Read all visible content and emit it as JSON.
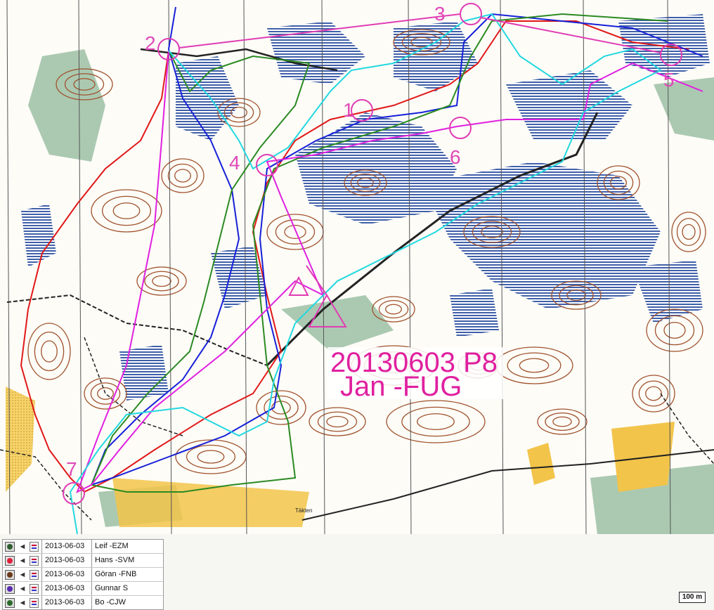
{
  "map": {
    "title_line1": "20130603 P8",
    "title_line2": "Jan -FUG",
    "place_label": "Täkten",
    "controls": [
      "1",
      "2",
      "3",
      "4",
      "5",
      "6",
      "7"
    ]
  },
  "legend": {
    "rows": [
      {
        "date": "2013-06-03",
        "name": "Leif -EZM",
        "color": "#2f5e2f"
      },
      {
        "date": "2013-06-03",
        "name": "Hans -SVM",
        "color": "#e0203a"
      },
      {
        "date": "2013-06-03",
        "name": "Göran -FNB",
        "color": "#6b3a1a"
      },
      {
        "date": "2013-06-03",
        "name": "Gunnar S",
        "color": "#5a2ab0"
      },
      {
        "date": "2013-06-03",
        "name": "Bo -CJW",
        "color": "#2a6a2a"
      }
    ]
  },
  "scale": {
    "label": "100 m"
  },
  "colors": {
    "route_red": "#e01818",
    "route_blue": "#1620d8",
    "route_green": "#2b8a22",
    "route_magenta": "#e020e0",
    "route_cyan": "#22d8e0",
    "course": "#e03cb4",
    "contour": "#a0522d",
    "marsh": "#3f5fa8",
    "field": "#f2c44a"
  }
}
